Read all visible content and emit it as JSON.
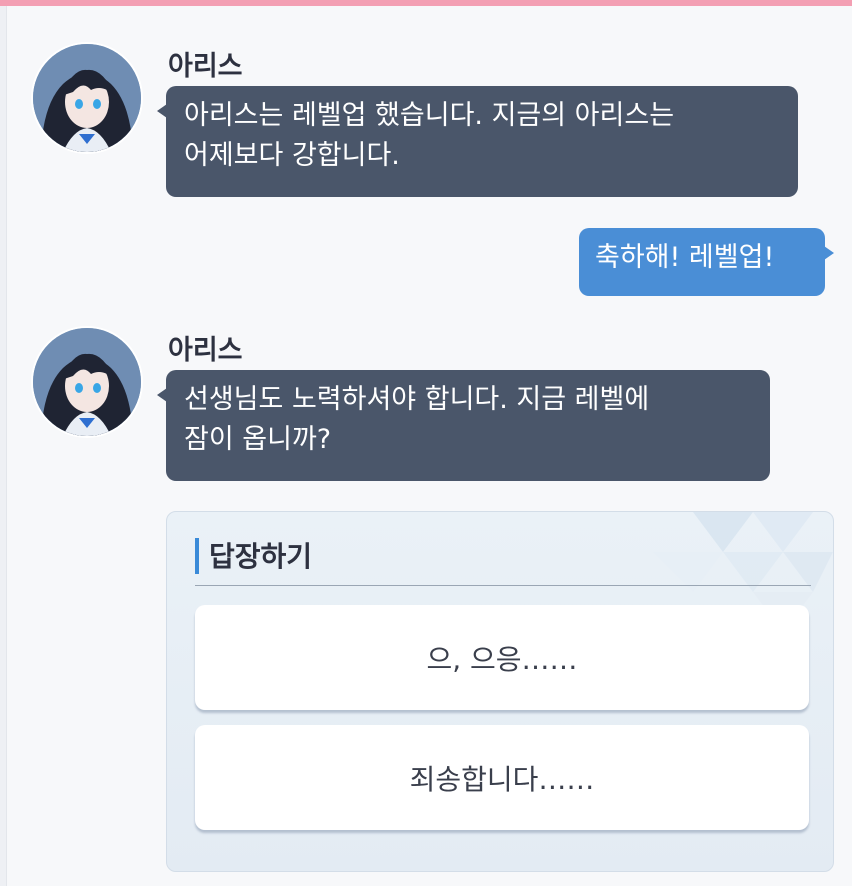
{
  "chat": {
    "messages": [
      {
        "sender": "아리스",
        "direction": "incoming",
        "lines": [
          "아리스는 레벨업 했습니다. 지금의 아리스는",
          "어제보다 강합니다."
        ]
      },
      {
        "direction": "outgoing",
        "lines": [
          "축하해! 레벨업!"
        ]
      },
      {
        "sender": "아리스",
        "direction": "incoming",
        "lines": [
          "선생님도 노력하셔야 합니다. 지금 레벨에",
          "잠이 옵니까?"
        ]
      }
    ]
  },
  "reply": {
    "title": "답장하기",
    "options": [
      "으, 으응……",
      "죄송합니다……"
    ]
  },
  "colors": {
    "top_bar": "#f39fb3",
    "incoming_bubble": "#4a566a",
    "outgoing_bubble": "#4a8ed6",
    "reply_accent": "#3a8ad8"
  },
  "icons": {
    "avatar": "student-avatar-icon"
  }
}
